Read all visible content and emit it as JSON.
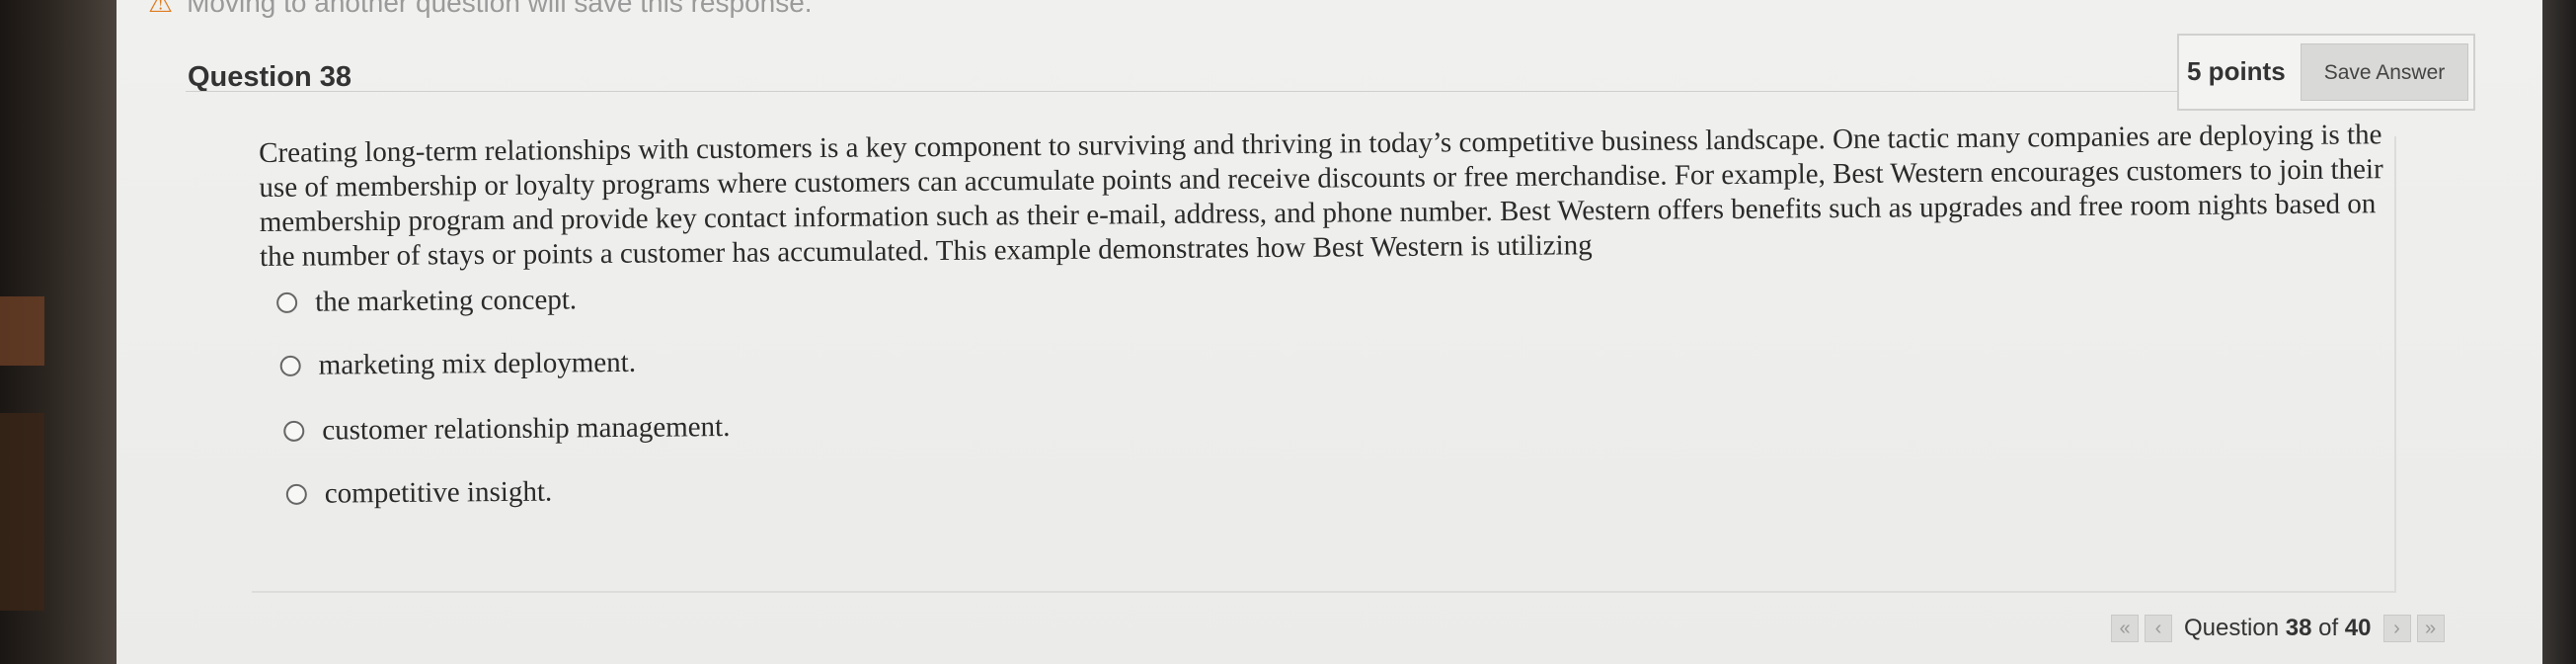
{
  "top_notice": "Moving to another question will save this response.",
  "question": {
    "title": "Question 38",
    "points": "5 points",
    "save_label": "Save Answer",
    "prompt": "Creating long-term relationships with customers is a key component to surviving and thriving in today’s competitive business landscape. One tactic many companies are deploying is the use of membership or loyalty programs where customers can accumulate points and receive discounts or free merchandise. For example, Best Western encourages customers to join their membership program and provide key contact information such as their e-mail, address, and phone number. Best Western offers benefits such as upgrades and free room nights based on the number of stays or points a customer has accumulated. This example demonstrates how Best Western is utilizing",
    "options": [
      "the marketing concept.",
      "marketing mix deployment.",
      "customer relationship management.",
      "competitive insight."
    ],
    "selected_option": null
  },
  "navigation": {
    "label": "Question",
    "current": "38",
    "of_label": "of",
    "total": "40",
    "first_icon": "double-chevron-left-icon",
    "prev_icon": "chevron-left-icon",
    "next_icon": "chevron-right-icon",
    "last_icon": "double-chevron-right-icon"
  },
  "colors": {
    "page_background": "#f0f0ee",
    "warning_icon": "#e07b1f",
    "text": "#2a2a2a"
  }
}
